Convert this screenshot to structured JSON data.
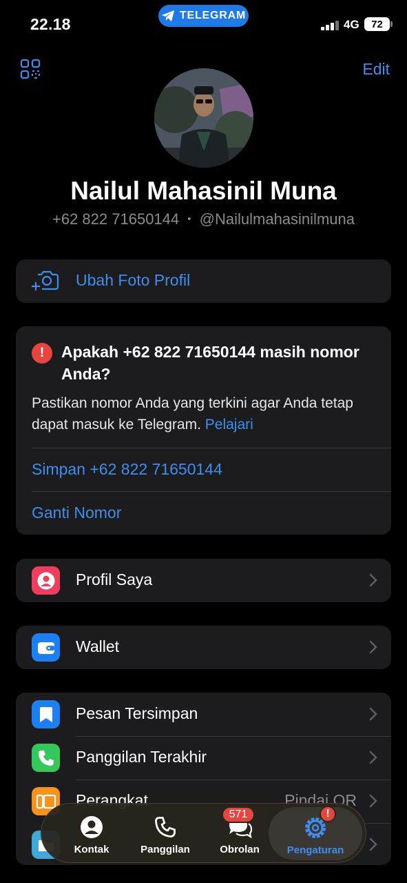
{
  "status_bar": {
    "time": "22.18",
    "pill_label": "TELEGRAM",
    "network": "4G",
    "battery": "72"
  },
  "header": {
    "edit_label": "Edit",
    "name": "Nailul Mahasinil Muna",
    "phone": "+62 822 71650144",
    "separator": "•",
    "username": "@Nailulmahasinilmuna"
  },
  "change_photo": {
    "label": "Ubah Foto Profil"
  },
  "phone_check": {
    "title": "Apakah  +62 822 71650144 masih nomor Anda?",
    "body": "Pastikan nomor Anda yang terkini agar Anda tetap dapat masuk ke Telegram.",
    "learn_link": "Pelajari",
    "keep_action": "Simpan +62 822 71650144",
    "change_action": "Ganti Nomor"
  },
  "menu": {
    "profile": {
      "label": "Profil Saya",
      "icon": "person-icon",
      "color": "#ef3d5e"
    },
    "wallet": {
      "label": "Wallet",
      "icon": "wallet-icon",
      "color": "#1c7ff2"
    },
    "saved": {
      "label": "Pesan Tersimpan",
      "icon": "bookmark-icon",
      "color": "#1c7ff2"
    },
    "calls": {
      "label": "Panggilan Terakhir",
      "icon": "phone-icon",
      "color": "#34c759"
    },
    "devices": {
      "label": "Perangkat",
      "value": "Pindai QR",
      "icon": "devices-icon",
      "color": "#f7931a"
    }
  },
  "tabbar": {
    "contacts": "Kontak",
    "calls": "Panggilan",
    "chats": "Obrolan",
    "chats_badge": "571",
    "settings": "Pengaturan",
    "settings_badge": "!"
  },
  "colors": {
    "accent": "#3e8ef0",
    "alert": "#e5463f"
  }
}
